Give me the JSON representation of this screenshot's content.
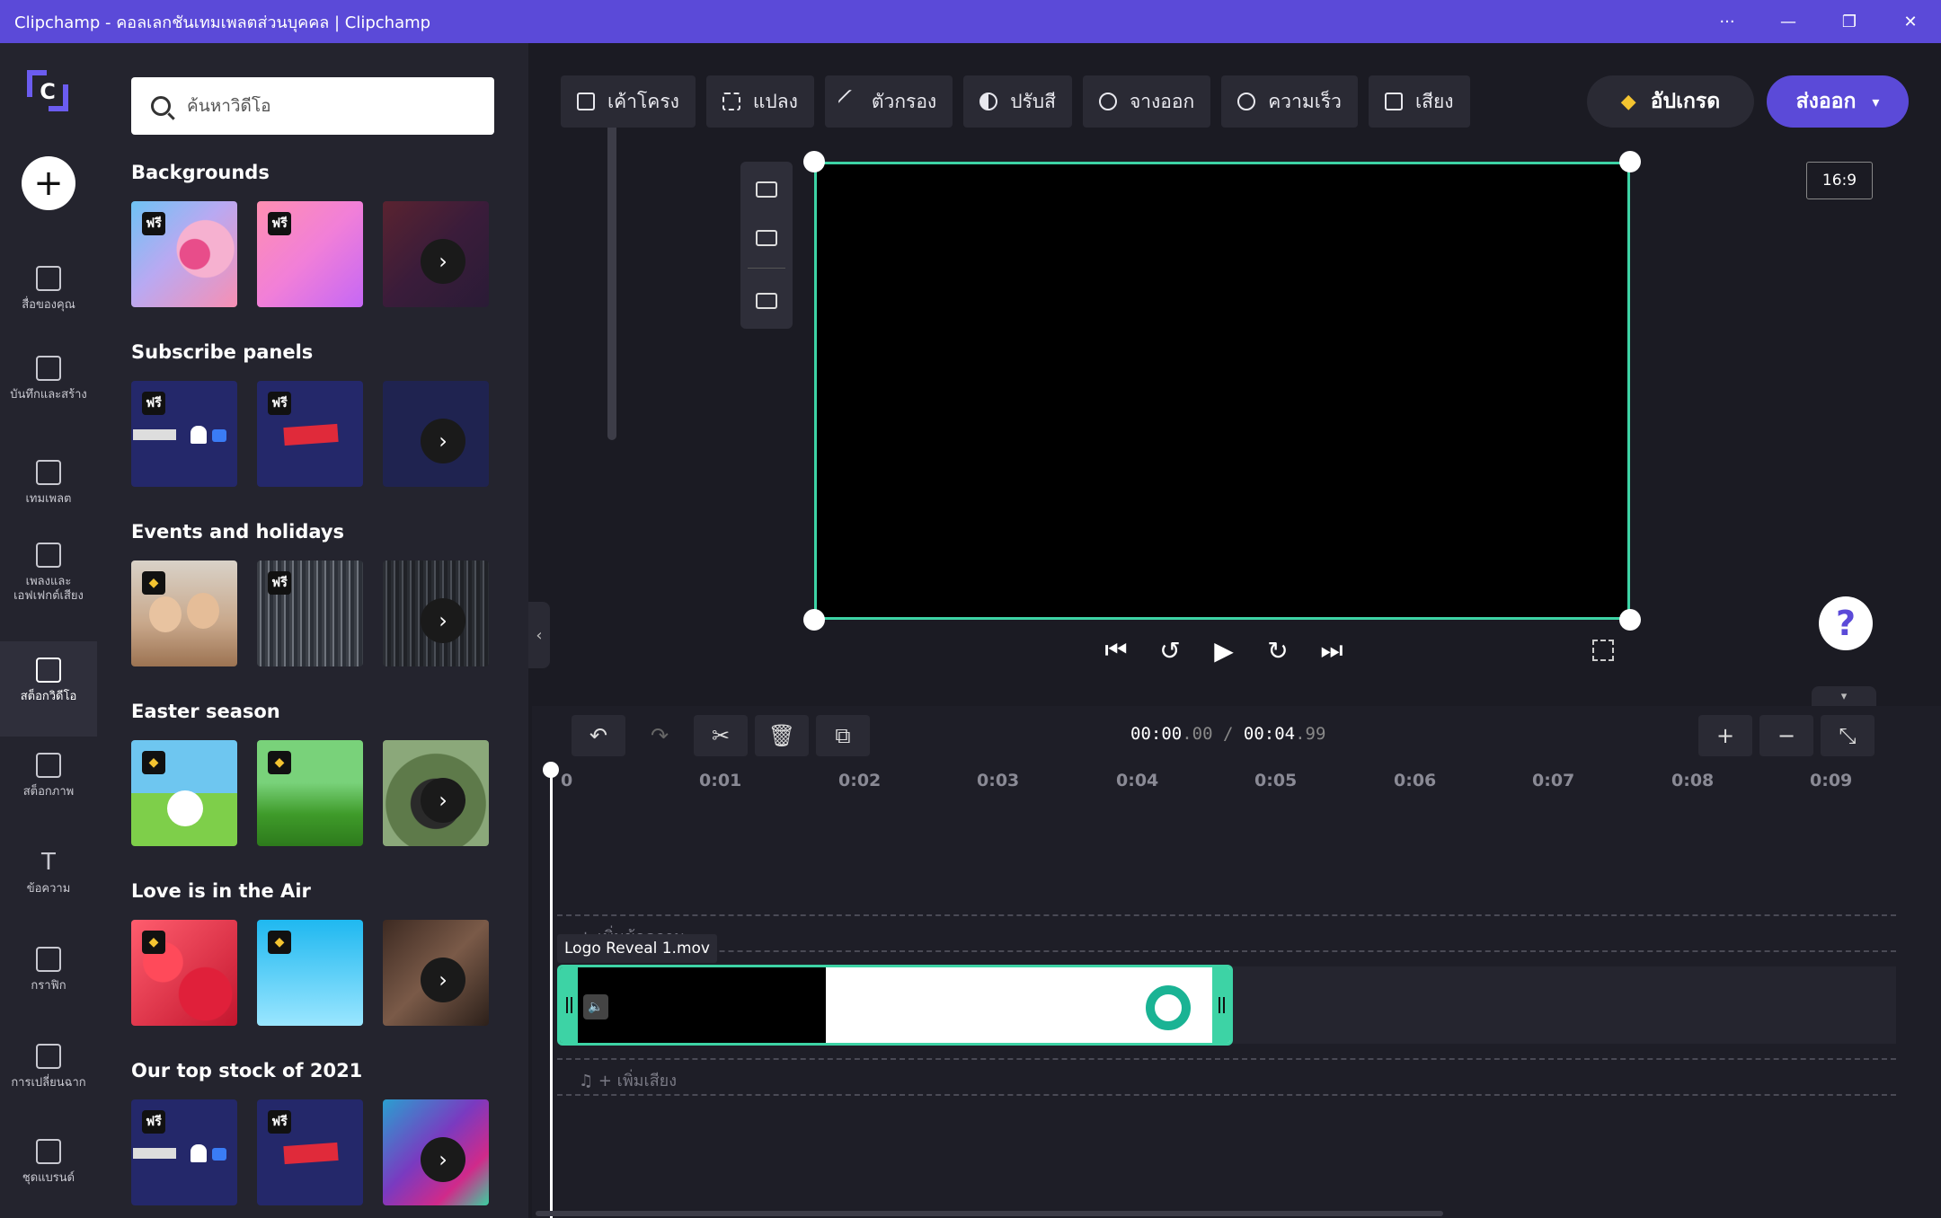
{
  "window": {
    "title": "Clipchamp - คอลเลกชันเทมเพลตส่วนบุคคล | Clipchamp",
    "buttons": [
      "···",
      "—",
      "❐",
      "✕"
    ]
  },
  "rail": {
    "create_label": "+",
    "items": [
      {
        "label": "สื่อของคุณ"
      },
      {
        "label": "บันทึกและสร้าง"
      },
      {
        "label": "เทมเพลต"
      },
      {
        "label": "เพลงและเอฟเฟกต์เสียง"
      },
      {
        "label": "สต็อกวิดีโอ"
      },
      {
        "label": "สต็อกภาพ"
      },
      {
        "label": "ข้อความ"
      },
      {
        "label": "กราฟิก"
      },
      {
        "label": "การเปลี่ยนฉาก"
      },
      {
        "label": "ชุดแบรนด์"
      }
    ]
  },
  "library": {
    "search_placeholder": "ค้นหาวิดีโอ",
    "free_badge": "ฟรี",
    "sections": [
      {
        "title": "Backgrounds"
      },
      {
        "title": "Subscribe panels"
      },
      {
        "title": "Events and holidays"
      },
      {
        "title": "Easter season"
      },
      {
        "title": "Love is in the Air"
      },
      {
        "title": "Our top stock of 2021"
      }
    ]
  },
  "toolbar": {
    "items": [
      {
        "label": "เค้าโครง"
      },
      {
        "label": "แปลง"
      },
      {
        "label": "ตัวกรอง"
      },
      {
        "label": "ปรับสี"
      },
      {
        "label": "จางออก"
      },
      {
        "label": "ความเร็ว"
      },
      {
        "label": "เสียง"
      }
    ],
    "upgrade_label": "อัปเกรด",
    "export_label": "ส่งออก"
  },
  "preview": {
    "aspect_ratio": "16:9",
    "help_label": "?"
  },
  "timeline": {
    "current_time_main": "00:00",
    "current_time_frac": ".00",
    "separator": "/",
    "duration_main": "00:04",
    "duration_frac": ".99",
    "ticks": [
      "0",
      "0:01",
      "0:02",
      "0:03",
      "0:04",
      "0:05",
      "0:06",
      "0:07",
      "0:08",
      "0:09"
    ],
    "text_track_label": "+ เพิ่มข้อความ",
    "clip_name": "Logo Reveal 1.mov",
    "audio_track_label": "+ เพิ่มเสียง"
  }
}
